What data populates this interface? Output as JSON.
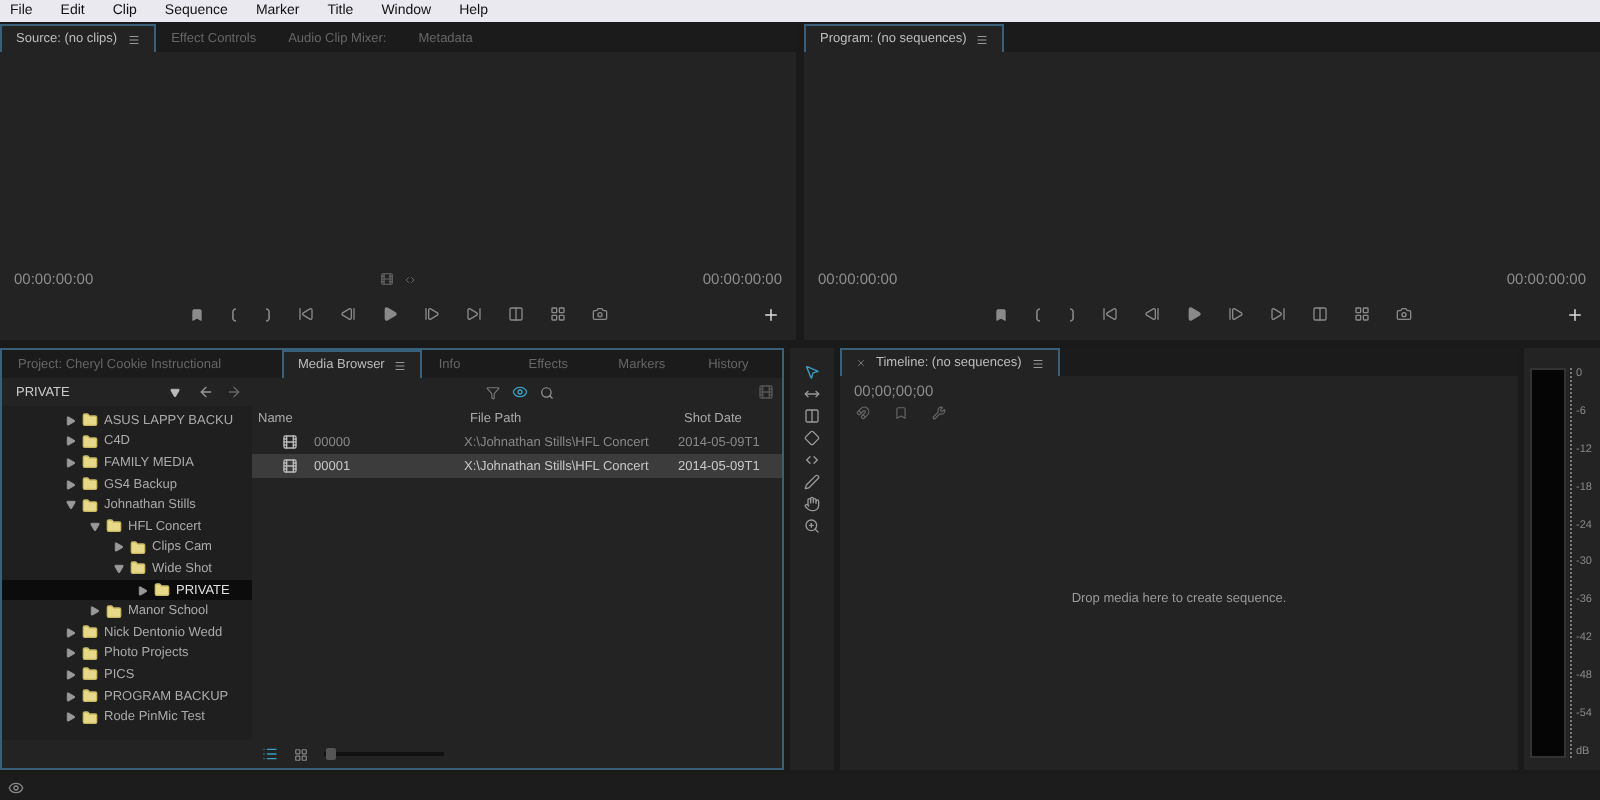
{
  "menu": [
    "File",
    "Edit",
    "Clip",
    "Sequence",
    "Marker",
    "Title",
    "Window",
    "Help"
  ],
  "source_panel": {
    "tabs": [
      {
        "label": "Source: (no clips)",
        "selected": true
      },
      {
        "label": "Effect Controls",
        "selected": false
      },
      {
        "label": "Audio Clip Mixer:",
        "selected": false
      },
      {
        "label": "Metadata",
        "selected": false
      }
    ],
    "timecode_left": "00:00:00:00",
    "timecode_right": "00:00:00:00"
  },
  "program_panel": {
    "tabs": [
      {
        "label": "Program: (no sequences)",
        "selected": true
      }
    ],
    "timecode_left": "00:00:00:00",
    "timecode_right": "00:00:00:00"
  },
  "project_panel": {
    "tabs": [
      {
        "label": "Project: Cheryl Cookie Instructional",
        "selected": false
      },
      {
        "label": "Media Browser",
        "selected": true
      },
      {
        "label": "Info",
        "selected": false
      },
      {
        "label": "Effects",
        "selected": false
      },
      {
        "label": "Markers",
        "selected": false
      },
      {
        "label": "History",
        "selected": false
      }
    ],
    "location": "PRIVATE",
    "tree": [
      {
        "label": "ASUS LAPPY BACKU",
        "expanded": false,
        "selected": false
      },
      {
        "label": "C4D",
        "expanded": false,
        "selected": false
      },
      {
        "label": "FAMILY MEDIA",
        "expanded": false,
        "selected": false
      },
      {
        "label": "GS4 Backup",
        "expanded": false,
        "selected": false
      },
      {
        "label": "Johnathan Stills",
        "expanded": true,
        "selected": false,
        "children": [
          {
            "label": "HFL Concert",
            "expanded": true,
            "selected": false,
            "children": [
              {
                "label": "Clips Cam",
                "expanded": false,
                "selected": false
              },
              {
                "label": "Wide Shot",
                "expanded": true,
                "selected": false,
                "children": [
                  {
                    "label": "PRIVATE",
                    "expanded": false,
                    "selected": true
                  }
                ]
              }
            ]
          },
          {
            "label": "Manor School",
            "expanded": false,
            "selected": false
          }
        ]
      },
      {
        "label": "Nick Dentonio Wedd",
        "expanded": false,
        "selected": false
      },
      {
        "label": "Photo Projects",
        "expanded": false,
        "selected": false
      },
      {
        "label": "PICS",
        "expanded": false,
        "selected": false
      },
      {
        "label": "PROGRAM BACKUP",
        "expanded": false,
        "selected": false
      },
      {
        "label": "Rode PinMic Test",
        "expanded": false,
        "selected": false
      }
    ],
    "columns": [
      "Name",
      "File Path",
      "Shot Date"
    ],
    "zoom_slider": {
      "level": 0.05
    },
    "files": [
      {
        "name": "00000",
        "path": "X:\\Johnathan Stills\\HFL Concert",
        "date": "2014-05-09T1",
        "selected": false
      },
      {
        "name": "00001",
        "path": "X:\\Johnathan Stills\\HFL Concert",
        "date": "2014-05-09T1",
        "selected": true
      }
    ]
  },
  "timeline": {
    "title": "Timeline: (no sequences)",
    "timecode": "00;00;00;00",
    "message": "Drop media here to create sequence."
  },
  "audio_meter": {
    "scale": [
      "0",
      "-6",
      "-12",
      "-18",
      "-24",
      "-30",
      "-36",
      "-42",
      "-48",
      "-54",
      "dB"
    ]
  }
}
